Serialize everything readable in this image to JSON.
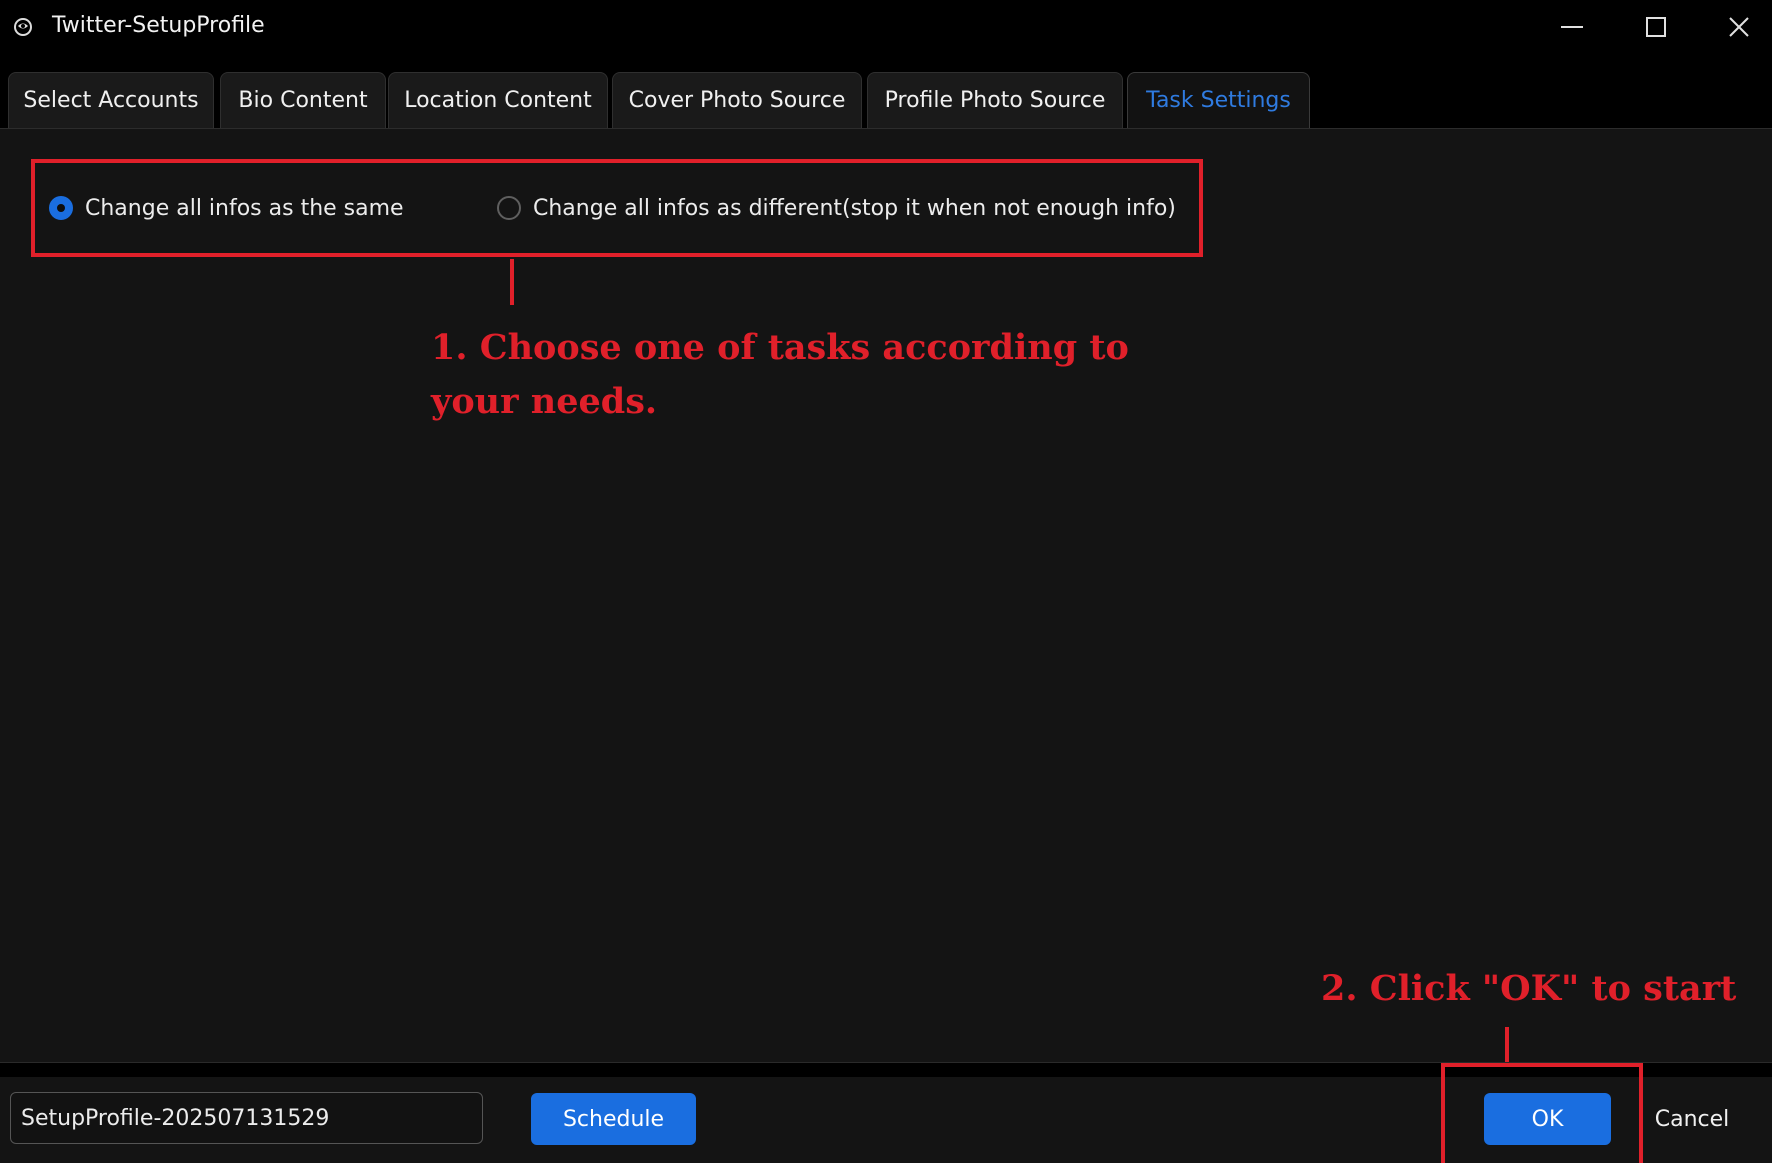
{
  "window": {
    "title": "Twitter-SetupProfile",
    "icons": {
      "app": "app-icon",
      "minimize": "minimize-icon",
      "maximize": "maximize-icon",
      "close": "close-icon"
    }
  },
  "tabs": [
    {
      "label": "Select Accounts",
      "active": false
    },
    {
      "label": "Bio Content",
      "active": false
    },
    {
      "label": "Location Content",
      "active": false
    },
    {
      "label": "Cover Photo Source",
      "active": false
    },
    {
      "label": "Profile Photo Source",
      "active": false
    },
    {
      "label": "Task Settings",
      "active": true
    }
  ],
  "task_settings": {
    "options": [
      {
        "label": "Change all infos as the same",
        "checked": true
      },
      {
        "label": "Change all infos as different(stop it when not enough info)",
        "checked": false
      }
    ]
  },
  "annotations": {
    "step1_line1": "1. Choose one of tasks according to",
    "step1_line2": "your needs.",
    "step2": "2. Click \"OK\" to start",
    "color": "#e0202a"
  },
  "footer": {
    "task_name_value": "SetupProfile-202507131529",
    "schedule_label": "Schedule",
    "ok_label": "OK",
    "cancel_label": "Cancel"
  },
  "colors": {
    "accent": "#1a6ee0",
    "active_tab_text": "#2f7be0",
    "background": "#141414"
  }
}
